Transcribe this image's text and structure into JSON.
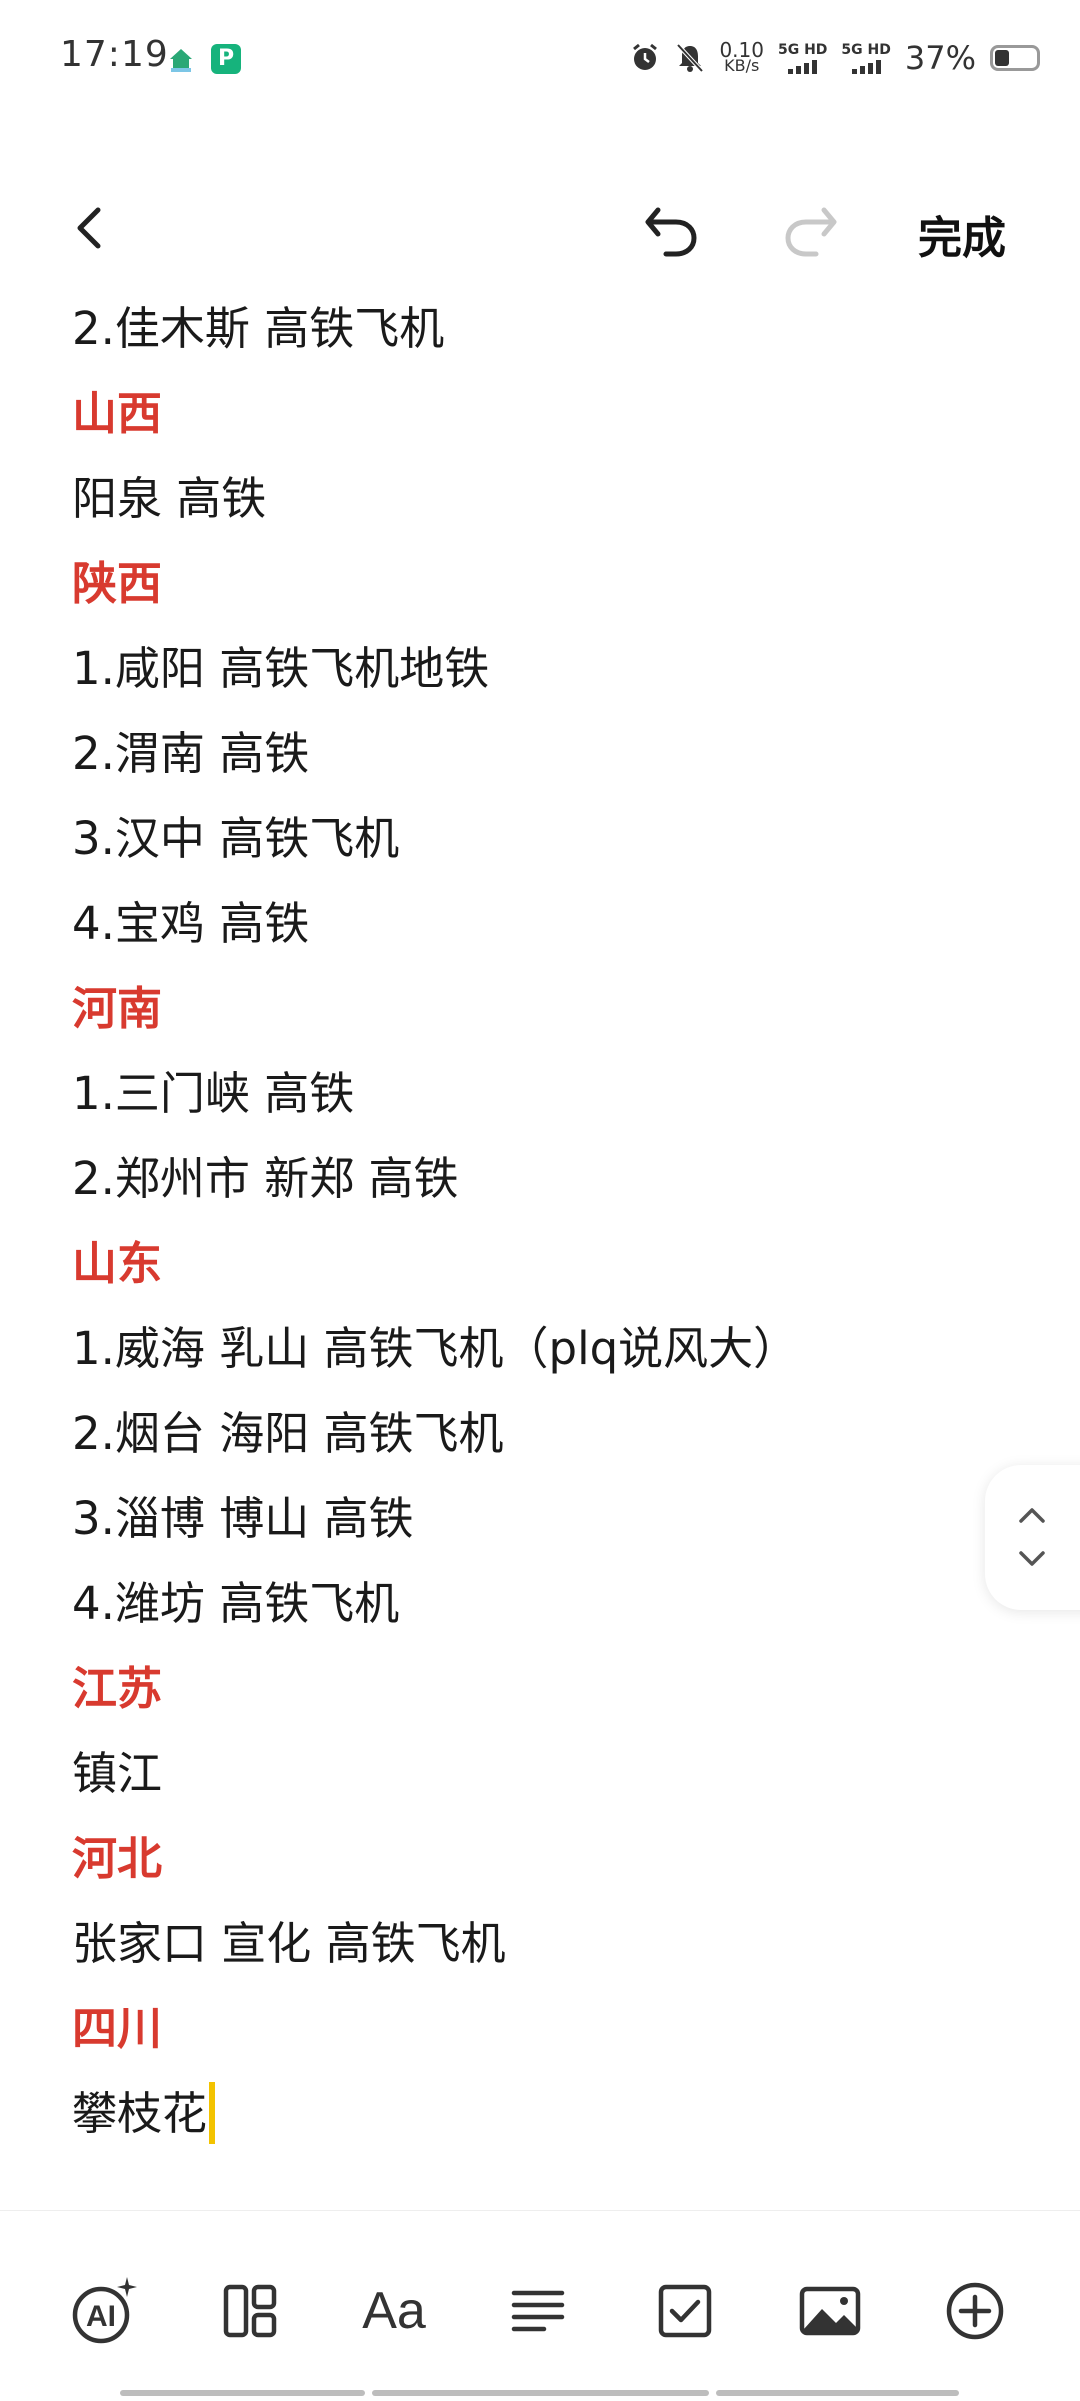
{
  "status_bar": {
    "time": "17:19",
    "net_speed_value": "0.10",
    "net_speed_unit": "KB/s",
    "sim1_label": "5G HD",
    "sim2_label": "5G HD",
    "battery_percent": "37%"
  },
  "toolbar": {
    "done_label": "完成"
  },
  "note": {
    "lines": [
      {
        "text": "2.佳木斯 高铁飞机",
        "heading": false
      },
      {
        "text": "山西",
        "heading": true
      },
      {
        "text": "阳泉 高铁",
        "heading": false
      },
      {
        "text": "陕西",
        "heading": true
      },
      {
        "text": "1.咸阳 高铁飞机地铁",
        "heading": false
      },
      {
        "text": "2.渭南 高铁",
        "heading": false
      },
      {
        "text": "3.汉中 高铁飞机",
        "heading": false
      },
      {
        "text": "4.宝鸡 高铁",
        "heading": false
      },
      {
        "text": "河南",
        "heading": true
      },
      {
        "text": "1.三门峡 高铁",
        "heading": false
      },
      {
        "text": "2.郑州市 新郑 高铁",
        "heading": false
      },
      {
        "text": "山东",
        "heading": true
      },
      {
        "text": "1.威海 乳山 高铁飞机（plq说风大）",
        "heading": false
      },
      {
        "text": "2.烟台 海阳 高铁飞机",
        "heading": false
      },
      {
        "text": "3.淄博 博山 高铁",
        "heading": false
      },
      {
        "text": "4.潍坊 高铁飞机",
        "heading": false
      },
      {
        "text": "江苏",
        "heading": true
      },
      {
        "text": "镇江",
        "heading": false
      },
      {
        "text": "河北",
        "heading": true
      },
      {
        "text": "张家口 宣化 高铁飞机",
        "heading": false
      },
      {
        "text": "四川",
        "heading": true
      },
      {
        "text": "攀枝花",
        "heading": false
      }
    ]
  },
  "bottom_toolbar": {
    "text_style_label": "Aa",
    "ai_label": "AI",
    "icons": [
      "ai-assistant-icon",
      "layout-icon",
      "text-format-icon",
      "paragraph-align-icon",
      "checklist-icon",
      "image-icon",
      "add-icon"
    ]
  },
  "colors": {
    "heading": "#d83a2f",
    "cursor": "#f3c300",
    "text": "#1a1a1a"
  }
}
